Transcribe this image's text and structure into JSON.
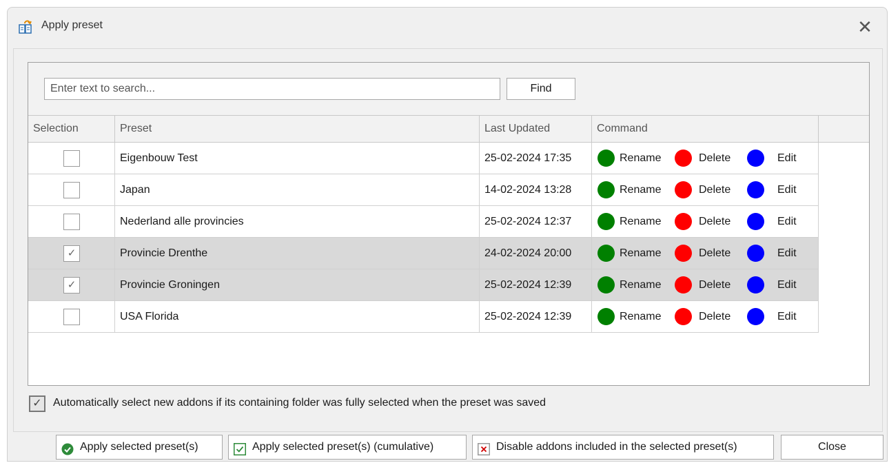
{
  "window": {
    "title": "Apply preset",
    "close_glyph": "✕"
  },
  "search": {
    "placeholder": "Enter text to search...",
    "value": "",
    "find_label": "Find"
  },
  "columns": [
    "Selection",
    "Preset",
    "Last Updated",
    "Command"
  ],
  "commands": {
    "rename": {
      "label": "Rename",
      "color": "#008000"
    },
    "delete": {
      "label": "Delete",
      "color": "#ff0000"
    },
    "edit": {
      "label": "Edit",
      "color": "#0000ff"
    }
  },
  "rows": [
    {
      "checked": false,
      "preset": "Eigenbouw Test",
      "updated": "25-02-2024 17:35"
    },
    {
      "checked": false,
      "preset": "Japan",
      "updated": "14-02-2024 13:28"
    },
    {
      "checked": false,
      "preset": "Nederland alle provincies",
      "updated": "25-02-2024 12:37"
    },
    {
      "checked": true,
      "preset": "Provincie Drenthe",
      "updated": "24-02-2024 20:00"
    },
    {
      "checked": true,
      "preset": "Provincie Groningen",
      "updated": "25-02-2024 12:39"
    },
    {
      "checked": false,
      "preset": "USA Florida",
      "updated": "25-02-2024 12:39"
    }
  ],
  "auto_select": {
    "checked": true,
    "label": "Automatically select new addons if its containing folder was fully selected when the preset was saved"
  },
  "footer": {
    "apply": "Apply selected preset(s)",
    "apply_cumulative": "Apply selected preset(s) (cumulative)",
    "disable": "Disable addons included in the selected preset(s)",
    "close": "Close"
  },
  "icons": {
    "title": "apply-preset-icon",
    "apply": "green-check-circle-icon",
    "apply_cumulative": "green-check-box-icon",
    "disable": "red-x-box-icon"
  },
  "colors": {
    "selected_row": "#d9d9d9",
    "check_green": "#2e8b3a",
    "x_red": "#d00000"
  }
}
